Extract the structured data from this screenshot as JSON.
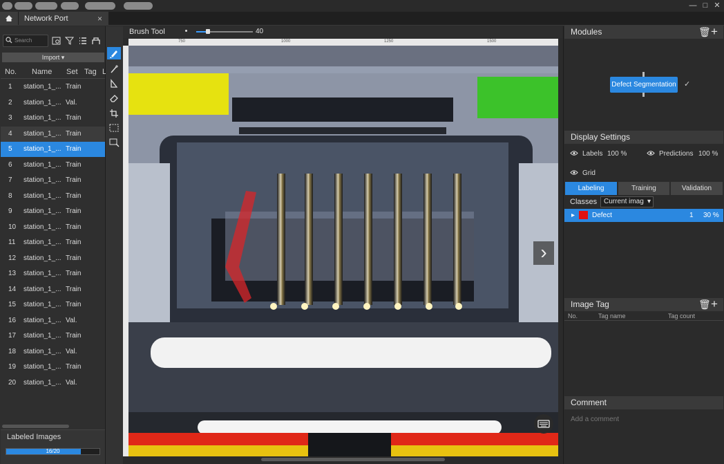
{
  "tab": {
    "title": "Network Port",
    "close": "×"
  },
  "window_controls": {
    "minimize": "—",
    "maximize": "□",
    "close": "✕"
  },
  "sidebar": {
    "search_placeholder": "Search",
    "import_label": "Import",
    "columns": [
      "No.",
      "Name",
      "Set",
      "Tag",
      "L"
    ],
    "rows": [
      {
        "no": "1",
        "name": "station_1_...",
        "set": "Train"
      },
      {
        "no": "2",
        "name": "station_1_...",
        "set": "Val."
      },
      {
        "no": "3",
        "name": "station_1_...",
        "set": "Train"
      },
      {
        "no": "4",
        "name": "station_1_...",
        "set": "Train"
      },
      {
        "no": "5",
        "name": "station_1_...",
        "set": "Train"
      },
      {
        "no": "6",
        "name": "station_1_...",
        "set": "Train"
      },
      {
        "no": "7",
        "name": "station_1_...",
        "set": "Train"
      },
      {
        "no": "8",
        "name": "station_1_...",
        "set": "Train"
      },
      {
        "no": "9",
        "name": "station_1_...",
        "set": "Train"
      },
      {
        "no": "10",
        "name": "station_1_...",
        "set": "Train"
      },
      {
        "no": "11",
        "name": "station_1_...",
        "set": "Train"
      },
      {
        "no": "12",
        "name": "station_1_...",
        "set": "Train"
      },
      {
        "no": "13",
        "name": "station_1_...",
        "set": "Train"
      },
      {
        "no": "14",
        "name": "station_1_...",
        "set": "Train"
      },
      {
        "no": "15",
        "name": "station_1_...",
        "set": "Train"
      },
      {
        "no": "16",
        "name": "station_1_...",
        "set": "Val."
      },
      {
        "no": "17",
        "name": "station_1_...",
        "set": "Train"
      },
      {
        "no": "18",
        "name": "station_1_...",
        "set": "Val."
      },
      {
        "no": "19",
        "name": "station_1_...",
        "set": "Train"
      },
      {
        "no": "20",
        "name": "station_1_...",
        "set": "Val."
      }
    ],
    "selected_row": "5",
    "labeled_title": "Labeled Images",
    "labeled_progress": "16/20",
    "labeled_fraction": 0.8
  },
  "toolbar": {
    "tool_name": "Brush Tool",
    "brush_size": "40",
    "brush_fraction": 0.17
  },
  "ruler": {
    "ticks": [
      "750",
      "1000",
      "1250",
      "1500"
    ]
  },
  "right": {
    "modules_title": "Modules",
    "module_node": "Defect Segmentation",
    "module_status": "✓",
    "display_title": "Display Settings",
    "labels_label": "Labels",
    "labels_value": "100 %",
    "predictions_label": "Predictions",
    "predictions_value": "100 %",
    "grid_label": "Grid",
    "tabs": [
      "Labeling",
      "Training",
      "Validation"
    ],
    "classes_label": "Classes",
    "classes_select": "Current imag",
    "class_row": {
      "name": "Defect",
      "count": "1",
      "percent": "30 %",
      "color": "#e01010"
    },
    "image_tag_title": "Image Tag",
    "image_tag_columns": [
      "No.",
      "Tag name",
      "Tag count"
    ],
    "comment_title": "Comment",
    "comment_placeholder": "Add a comment"
  },
  "colors": {
    "accent": "#2b88e0",
    "panel": "#2b2b2b",
    "defect": "#e01010"
  }
}
